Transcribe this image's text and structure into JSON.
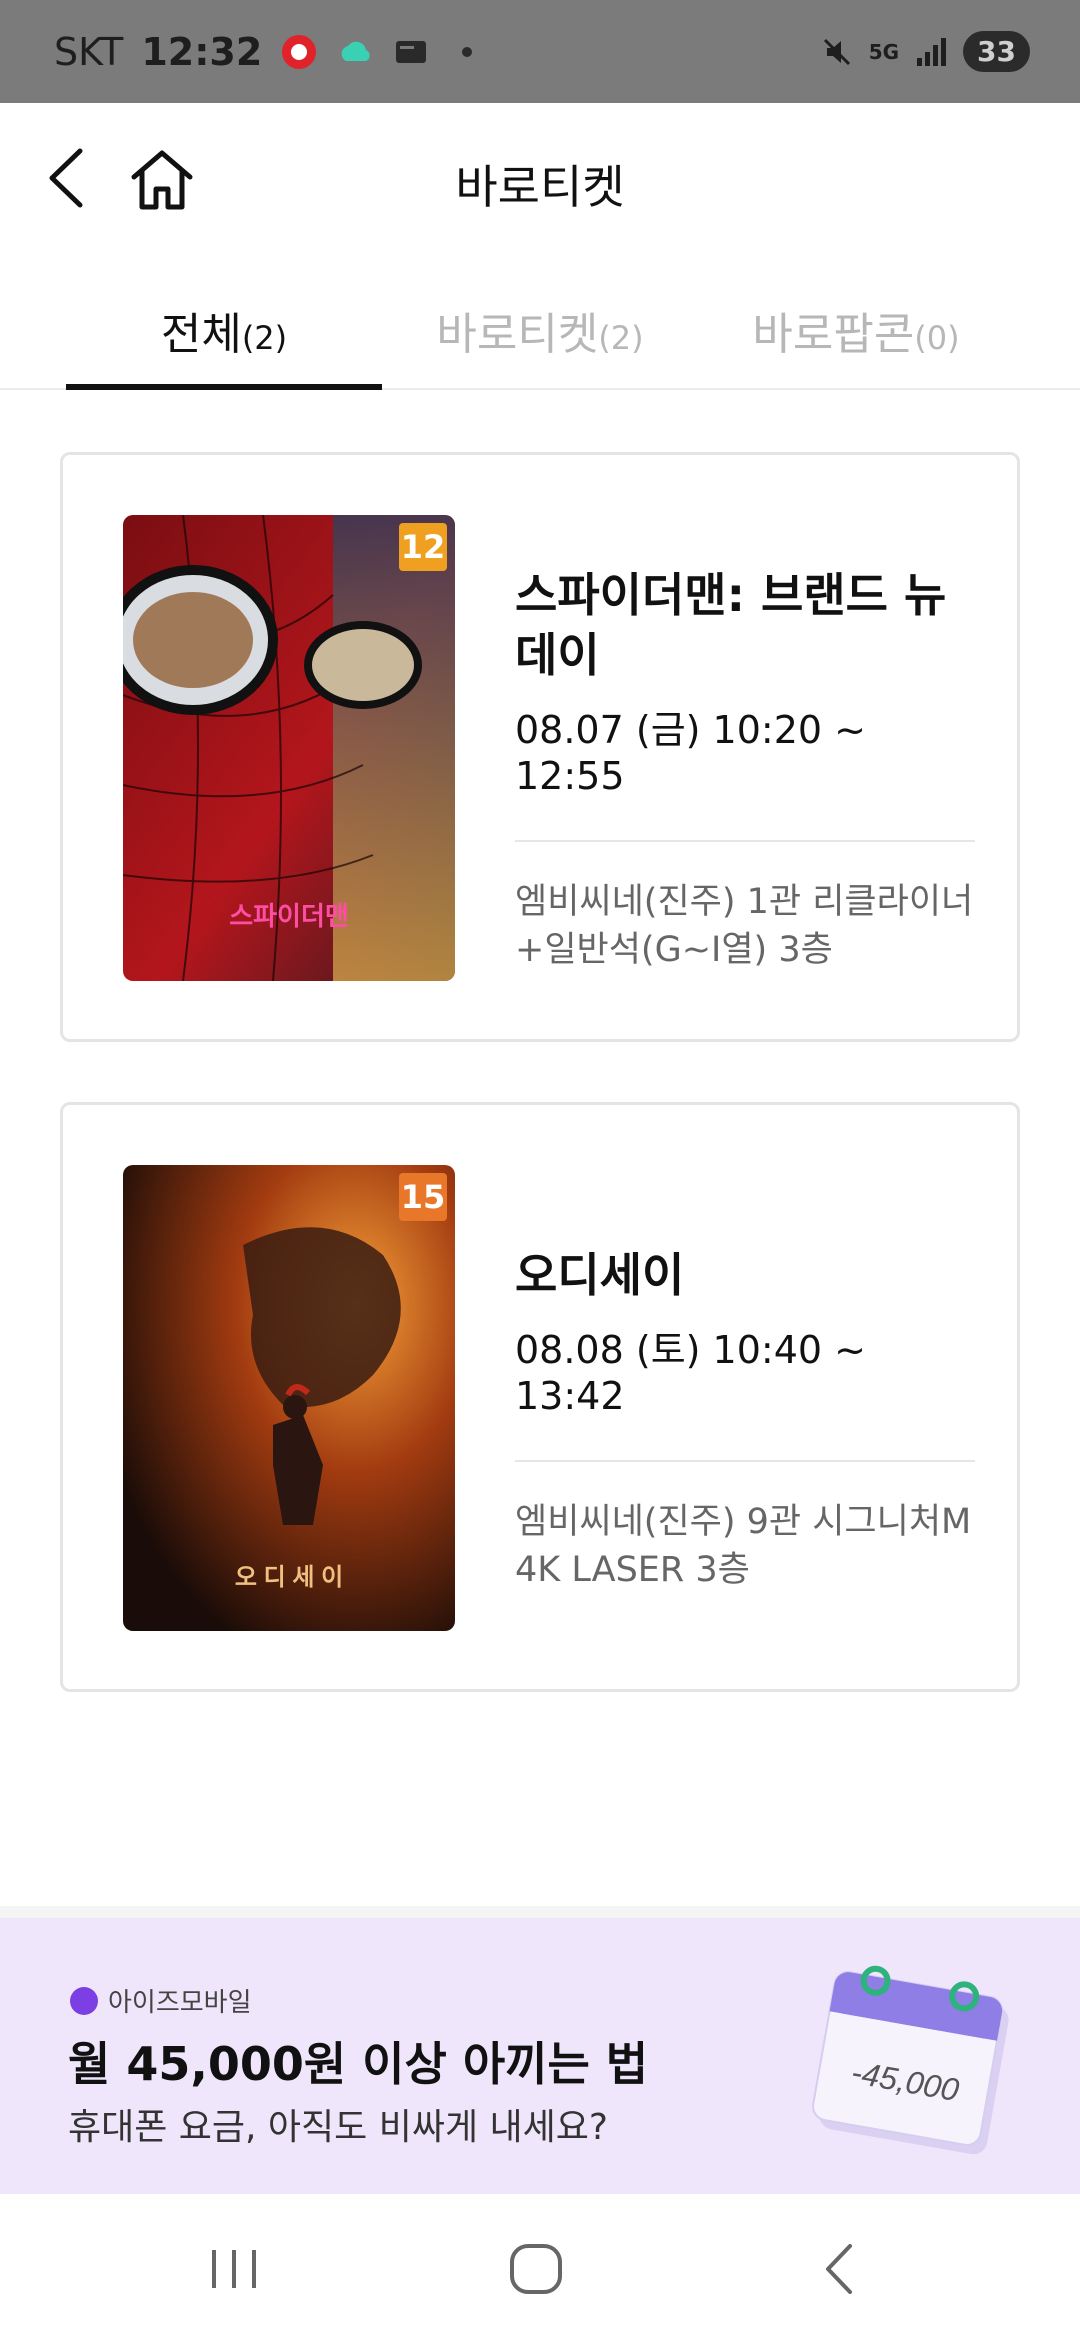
{
  "status_bar": {
    "carrier": "SKT",
    "time": "12:32",
    "network": "5G",
    "battery": "33"
  },
  "header": {
    "title": "바로티켓"
  },
  "tabs": [
    {
      "label": "전체",
      "count": "(2)",
      "active": true
    },
    {
      "label": "바로티켓",
      "count": "(2)",
      "active": false
    },
    {
      "label": "바로팝콘",
      "count": "(0)",
      "active": false
    }
  ],
  "tickets": [
    {
      "title": "스파이더맨: 브랜드 뉴 데이",
      "rating": "12",
      "rating_color": "#f0a020",
      "showtime": "08.07 (금) 10:20 ~ 12:55",
      "venue": "엠비씨네(진주) 1관 리클라이너+일반석(G~I열) 3층"
    },
    {
      "title": "오디세이",
      "rating": "15",
      "rating_color": "#e8772a",
      "showtime": "08.08 (토) 10:40 ~ 13:42",
      "venue": "엠비씨네(진주) 9관 시그니처M 4K LASER 3층"
    }
  ],
  "ad": {
    "brand": "아이즈모바일",
    "title": "월 45,000원 이상 아끼는 법",
    "subtitle": "휴대폰 요금, 아직도 비싸게 내세요?",
    "calendar_text": "-45,000"
  },
  "colors": {
    "accent": "#111111",
    "inactive_tab": "#b7b7b7",
    "ad_background": "#efe6fb"
  }
}
